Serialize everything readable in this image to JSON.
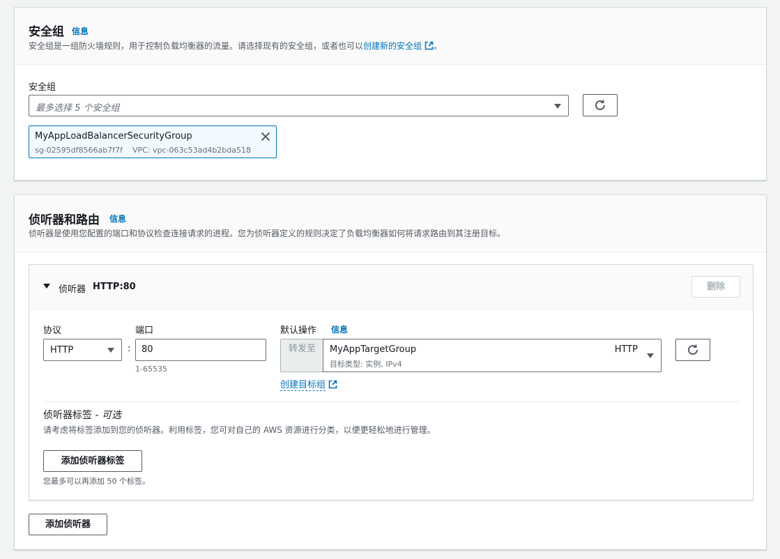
{
  "security_section": {
    "title": "安全组",
    "info": "信息",
    "description": "安全组是一组防火墙规则，用于控制负载均衡器的流量。请选择现有的安全组，或者也可以",
    "create_link": "创建新的安全组",
    "description_end": "。",
    "field_label": "安全组",
    "select_placeholder": "最多选择 5 个安全组",
    "token": {
      "name": "MyAppLoadBalancerSecurityGroup",
      "id": "sg-02595df8566ab7f7f",
      "vpc": "VPC: vpc-063c53ad4b2bda518"
    }
  },
  "listener_section": {
    "title": "侦听器和路由",
    "info": "信息",
    "description": "侦听器是使用您配置的端口和协议检查连接请求的进程。您为侦听器定义的规则决定了负载均衡器如何将请求路由到其注册目标。",
    "listener": {
      "header_prefix": "侦听器",
      "header_name": "HTTP:80",
      "remove_label": "删除",
      "protocol_label": "协议",
      "protocol_value": "HTTP",
      "colon": ":",
      "port_label": "端口",
      "port_value": "80",
      "port_hint": "1-65535",
      "default_action_label": "默认操作",
      "default_action_info": "信息",
      "forward_label": "转发至",
      "target_group": "MyAppTargetGroup",
      "target_protocol": "HTTP",
      "target_type": "目标类型: 实例, IPv4",
      "create_target_link": "创建目标组",
      "tags_title": "侦听器标签",
      "tags_dash": " - ",
      "tags_optional": "可选",
      "tags_description": "请考虑将标签添加到您的侦听器。利用标签，您可对自己的 AWS 资源进行分类，以便更轻松地进行管理。",
      "add_tag_label": "添加侦听器标签",
      "tag_limit": "您最多可以再添加 50 个标签。"
    },
    "add_listener_label": "添加侦听器"
  },
  "colors": {
    "link": "#0073bb",
    "token_border": "#0073bb",
    "token_bg": "#f1faff"
  }
}
